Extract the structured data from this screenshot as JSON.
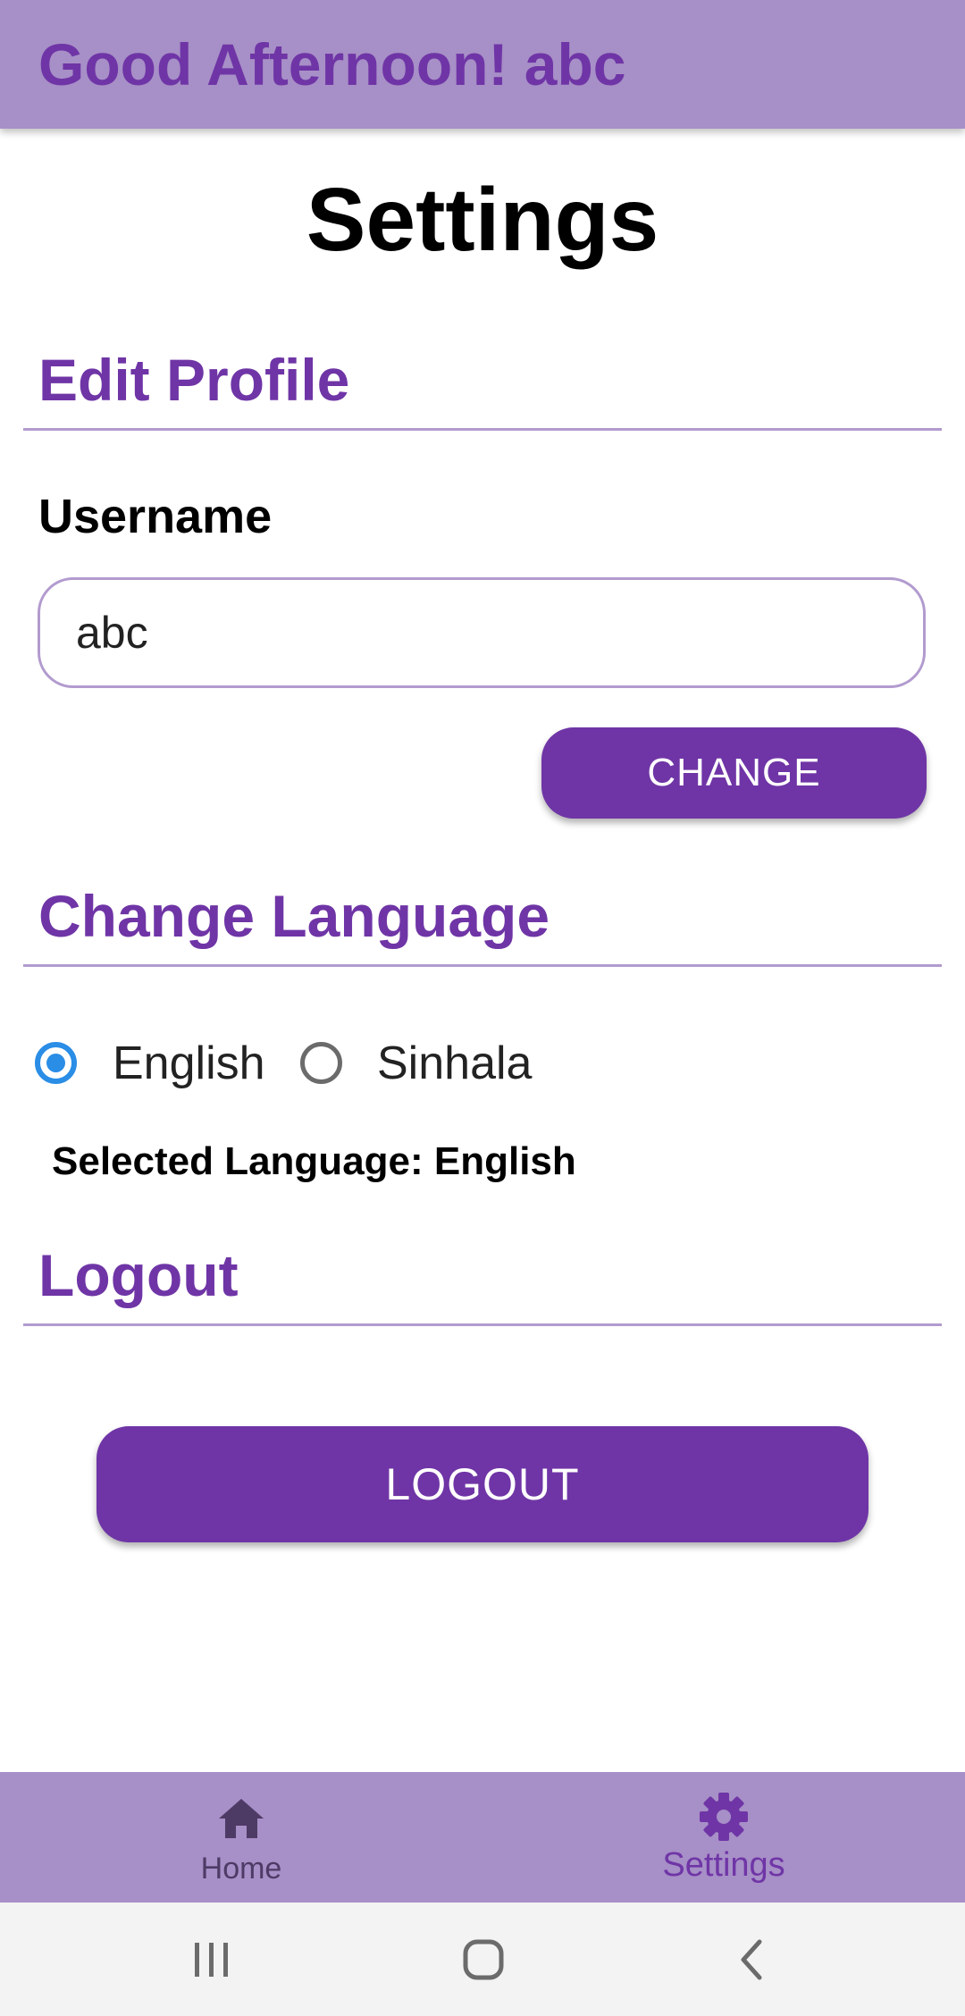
{
  "app_bar": {
    "greeting": "Good Afternoon! abc",
    "background_color": "#a78fc7",
    "title_color": "#6f35a6"
  },
  "page": {
    "title": "Settings"
  },
  "edit_profile": {
    "heading": "Edit Profile",
    "username_label": "Username",
    "username_value": "abc",
    "change_button_label": "CHANGE"
  },
  "change_language": {
    "heading": "Change Language",
    "options": [
      {
        "label": "English",
        "selected": true
      },
      {
        "label": "Sinhala",
        "selected": false
      }
    ],
    "selected_text": "Selected Language: English"
  },
  "logout": {
    "heading": "Logout",
    "button_label": "LOGOUT"
  },
  "bottom_nav": {
    "items": [
      {
        "label": "Home",
        "icon": "home-icon",
        "active": false
      },
      {
        "label": "Settings",
        "icon": "gear-icon",
        "active": true
      }
    ]
  },
  "system_nav": {
    "buttons": [
      "recents-icon",
      "home-circle-icon",
      "back-icon"
    ]
  },
  "colors": {
    "accent": "#6f35a6",
    "radio_selected": "#2a8de6",
    "divider": "#b29bcf"
  }
}
